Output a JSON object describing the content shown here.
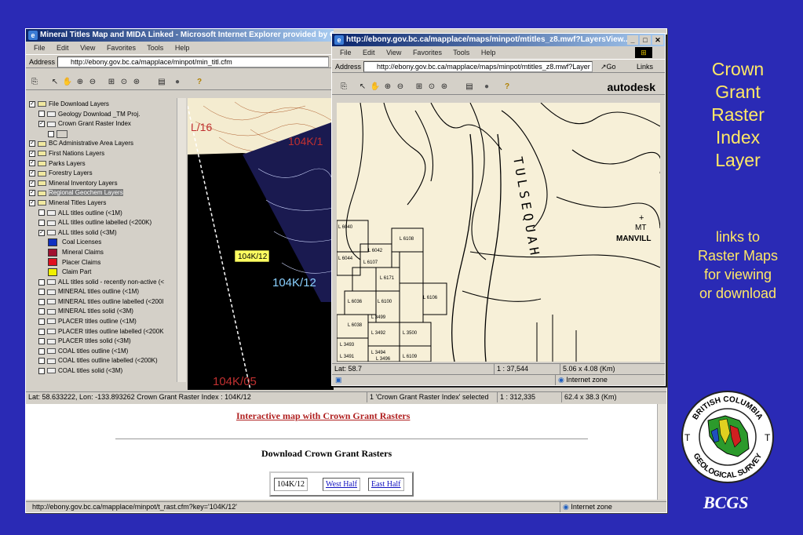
{
  "slide": {
    "heading_lines": [
      "Crown",
      "Grant",
      "Raster",
      "Index",
      "Layer"
    ],
    "sub_lines": [
      "links to",
      "Raster Maps",
      "for viewing",
      "or download"
    ],
    "logo_text_top": "BRITISH COLUMBIA",
    "logo_text_bottom": "GEOLOGICAL SURVEY",
    "logo_letter": "T",
    "footer_brand": "BCGS"
  },
  "back_window": {
    "title": "Mineral Titles Map and MIDA Linked - Microsoft Internet Explorer provided by Gov",
    "menu": [
      "File",
      "Edit",
      "View",
      "Favorites",
      "Tools",
      "Help"
    ],
    "address_label": "Address",
    "address_value": "http://ebony.gov.bc.ca/mapplace/minpot/min_titl.cfm",
    "status_coords": "Lat: 58.633222, Lon: -133.893262   Crown Grant Raster Index : 104K/12",
    "status_selected": "1 'Crown Grant Raster Index' selected",
    "status_scale": "1 : 312,335",
    "status_size": "62.4 x 38.3 (Km)",
    "page_link": "Interactive map with Crown Grant Rasters",
    "download_heading": "Download Crown Grant Rasters",
    "download_table": {
      "sheet": "104K/12",
      "west": "West Half",
      "east": "East Half"
    },
    "bottom_status_url": "http://ebony.gov.bc.ca/mapplace/minpot/t_rast.cfm?key='104K/12'",
    "bottom_status_zone": "Internet zone",
    "map_labels": {
      "tile_a": "L/16",
      "tile_b": "104K/1",
      "tile_c": "104K/12",
      "tile_d": "104K/05",
      "highlight": "104K/12"
    }
  },
  "layers": [
    {
      "checked": true,
      "icon": "folder",
      "label": "File Download Layers",
      "indent": 0
    },
    {
      "checked": false,
      "icon": "line",
      "label": "Geology Download _TM Proj.",
      "indent": 1
    },
    {
      "checked": true,
      "icon": "line",
      "label": "Crown Grant Raster Index",
      "indent": 1
    },
    {
      "checked": false,
      "icon": "box",
      "label": "",
      "indent": 2
    },
    {
      "checked": true,
      "icon": "folder",
      "label": "BC Administrative Area Layers",
      "indent": 0
    },
    {
      "checked": true,
      "icon": "folder",
      "label": "First Nations Layers",
      "indent": 0
    },
    {
      "checked": true,
      "icon": "folder",
      "label": "Parks Layers",
      "indent": 0
    },
    {
      "checked": true,
      "icon": "folder",
      "label": "Forestry Layers",
      "indent": 0
    },
    {
      "checked": true,
      "icon": "folder",
      "label": "Mineral Inventory Layers",
      "indent": 0
    },
    {
      "checked": true,
      "icon": "folder",
      "label": "Regional Geochem Layers",
      "indent": 0,
      "selected": true
    },
    {
      "checked": true,
      "icon": "folder",
      "label": "Mineral Titles Layers",
      "indent": 0
    },
    {
      "checked": false,
      "icon": "line",
      "label": "ALL titles outline (<1M)",
      "indent": 1
    },
    {
      "checked": false,
      "icon": "line",
      "label": "ALL titles outline labelled (<200K)",
      "indent": 1
    },
    {
      "checked": true,
      "icon": "line",
      "label": "ALL titles solid (<3M)",
      "indent": 1
    },
    {
      "swatch": "#1030c0",
      "label": "Coal Licenses",
      "indent": 2
    },
    {
      "swatch": "#a01030",
      "label": "Mineral Claims",
      "indent": 2
    },
    {
      "swatch": "#e01020",
      "label": "Placer Claims",
      "indent": 2
    },
    {
      "swatch": "#f0f000",
      "label": "Claim Part",
      "indent": 2
    },
    {
      "checked": false,
      "icon": "line",
      "label": "ALL titles solid - recently non-active (<",
      "indent": 1
    },
    {
      "checked": false,
      "icon": "line",
      "label": "MINERAL titles outline (<1M)",
      "indent": 1
    },
    {
      "checked": false,
      "icon": "line",
      "label": "MINERAL titles outline labelled (<200l",
      "indent": 1
    },
    {
      "checked": false,
      "icon": "line",
      "label": "MINERAL titles solid (<3M)",
      "indent": 1
    },
    {
      "checked": false,
      "icon": "line",
      "label": "PLACER titles outline (<1M)",
      "indent": 1
    },
    {
      "checked": false,
      "icon": "line",
      "label": "PLACER titles outline labelled (<200K",
      "indent": 1
    },
    {
      "checked": false,
      "icon": "line",
      "label": "PLACER titles solid (<3M)",
      "indent": 1
    },
    {
      "checked": false,
      "icon": "line",
      "label": "COAL titles outline (<1M)",
      "indent": 1
    },
    {
      "checked": false,
      "icon": "line",
      "label": "COAL titles outline labelled (<200K)",
      "indent": 1
    },
    {
      "checked": false,
      "icon": "line",
      "label": "COAL titles solid (<3M)",
      "indent": 1
    }
  ],
  "front_window": {
    "title": "http://ebony.gov.bc.ca/mapplace/maps/minpot/mtitles_z8.mwf?LayersView...",
    "menu": [
      "File",
      "Edit",
      "View",
      "Favorites",
      "Tools",
      "Help"
    ],
    "address_label": "Address",
    "address_value": "http://ebony.gov.bc.ca/mapplace/maps/minpot/mtitles_z8.mwf?Layer",
    "go_label": "Go",
    "links_label": "Links",
    "brand": "autodesk",
    "status_lat": "Lat: 58.7",
    "status_scale": "1 : 37,544",
    "status_size": "5.06 x 4.08 (Km)",
    "status_zone": "Internet zone",
    "map_labels": {
      "river": "TULSEQUAH",
      "peak_line1": "MT",
      "peak_line2": "MANVILL",
      "lots": [
        "L 6040",
        "L 6044",
        "L 6042",
        "L 6107",
        "L 6108",
        "L 6171",
        "L 6036",
        "L 6100",
        "L 6106",
        "L 6038",
        "L 3499",
        "L 3492",
        "L 3500",
        "L 3493",
        "L 3494",
        "L 3491",
        "L 3496",
        "L 6109"
      ]
    }
  }
}
